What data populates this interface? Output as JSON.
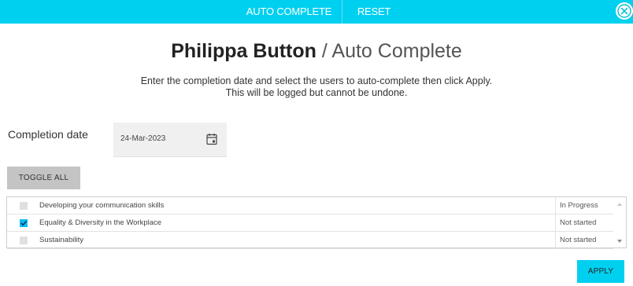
{
  "topbar": {
    "tabs": [
      {
        "label": "AUTO COMPLETE"
      },
      {
        "label": "RESET"
      }
    ],
    "accent_color": "#00d0f0",
    "close_icon": "close-icon"
  },
  "header": {
    "user_name": "Philippa Button",
    "separator": "/",
    "page_title": "Auto Complete"
  },
  "instructions": {
    "line1": "Enter the completion date and select the users to auto-complete then click Apply.",
    "line2": "This will be logged but cannot be undone."
  },
  "completion_date": {
    "label": "Completion date",
    "value": "24-Mar-2023",
    "icon": "calendar-icon"
  },
  "toggle_all_label": "TOGGLE ALL",
  "courses": [
    {
      "name": "Developing your communication skills",
      "status": "In Progress",
      "checked": false
    },
    {
      "name": "Equality & Diversity in the Workplace",
      "status": "Not started",
      "checked": true
    },
    {
      "name": "Sustainability",
      "status": "Not started",
      "checked": false
    }
  ],
  "apply_label": "APPLY"
}
